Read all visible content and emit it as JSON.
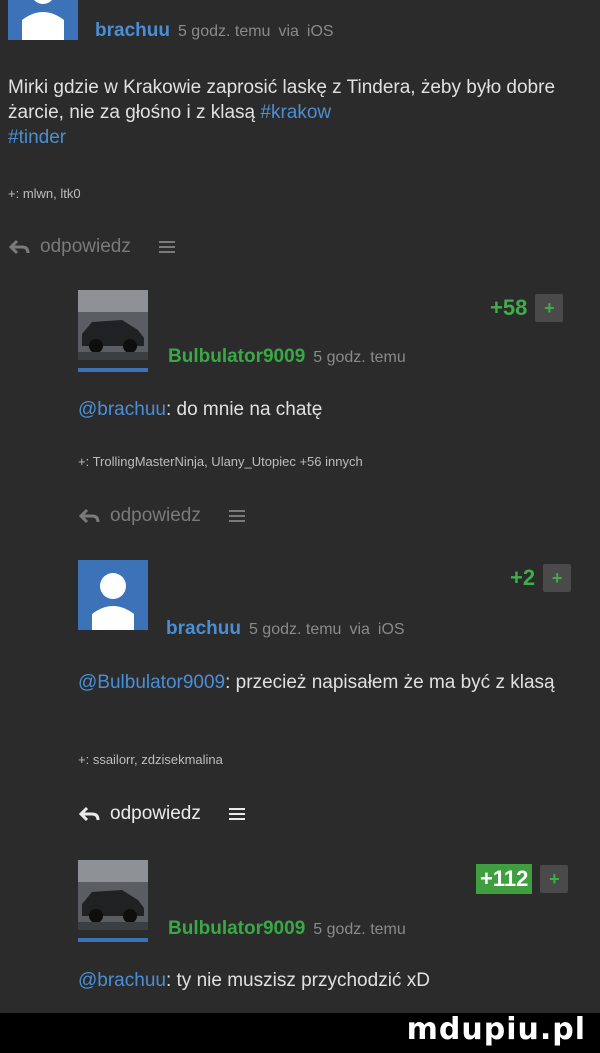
{
  "post1": {
    "author": "brachuu",
    "time": "5 godz. temu",
    "via": "via",
    "platform": "iOS",
    "text_plain": "Mirki gdzie w Krakowie zaprosić laskę z Tindera, żeby było dobre żarcie, nie za głośno i z klasą ",
    "tag1": "#krakow",
    "tag2": "#tinder",
    "voters": "+: mlwn, ltk0",
    "reply_label": "odpowiedz"
  },
  "comment1": {
    "author": "Bulbulator9009",
    "time": "5 godz. temu",
    "score": "+58",
    "plus": "+",
    "mention": "@brachuu",
    "text": ": do mnie na chatę",
    "voters": "+: TrollingMasterNinja, Ulany_Utopiec +56 innych",
    "reply_label": "odpowiedz"
  },
  "comment2": {
    "author": "brachuu",
    "time": "5 godz. temu",
    "via": "via",
    "platform": "iOS",
    "score": "+2",
    "plus": "+",
    "mention": "@Bulbulator9009",
    "text": ": przecież napisałem że ma być z klasą",
    "voters": "+: ssailorr, zdzisekmalina",
    "reply_label": "odpowiedz"
  },
  "comment3": {
    "author": "Bulbulator9009",
    "time": "5 godz. temu",
    "score": "+112",
    "plus": "+",
    "mention": "@brachuu",
    "text": ": ty nie muszisz przychodzić xD"
  },
  "watermark": "mdupiu.pl",
  "colors": {
    "background": "#2b2b2b",
    "link": "#4a8fd6",
    "green": "#3fae4a",
    "avatar_blue": "#3b72b8"
  }
}
